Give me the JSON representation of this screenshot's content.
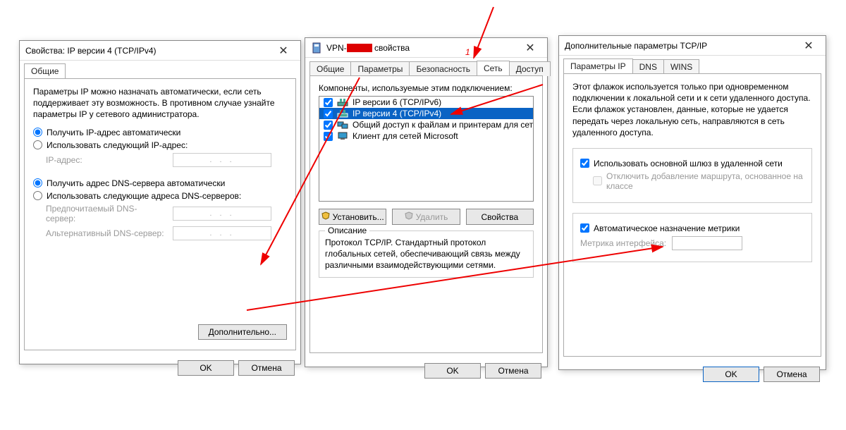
{
  "annotations": {
    "label_1": "1"
  },
  "dialog1": {
    "title": "Свойства: IP версии 4 (TCP/IPv4)",
    "tabs": {
      "general": "Общие"
    },
    "intro": "Параметры IP можно назначать автоматически, если сеть поддерживает эту возможность. В противном случае узнайте параметры IP у сетевого администратора.",
    "radio_auto_ip": "Получить IP-адрес автоматически",
    "radio_manual_ip": "Использовать следующий IP-адрес:",
    "ip_label": "IP-адрес:",
    "ip_placeholder": ".     .     .",
    "radio_auto_dns": "Получить адрес DNS-сервера автоматически",
    "radio_manual_dns": "Использовать следующие адреса DNS-серверов:",
    "dns_pref": "Предпочитаемый DNS-сервер:",
    "dns_alt": "Альтернативный DNS-сервер:",
    "advanced_btn": "Дополнительно...",
    "ok": "OK",
    "cancel": "Отмена"
  },
  "dialog2": {
    "title_prefix": "VPN-",
    "title_suffix": "свойства",
    "tabs": {
      "general": "Общие",
      "params": "Параметры",
      "security": "Безопасность",
      "network": "Сеть",
      "access": "Доступ"
    },
    "list_caption": "Компоненты, используемые этим подключением:",
    "items": [
      {
        "label": "IP версии 6 (TCP/IPv6)",
        "checked": true,
        "selected": false,
        "icon": "proto"
      },
      {
        "label": "IP версии 4 (TCP/IPv4)",
        "checked": true,
        "selected": true,
        "icon": "proto"
      },
      {
        "label": "Общий доступ к файлам и принтерам для сетей Micr...",
        "checked": true,
        "selected": false,
        "icon": "share"
      },
      {
        "label": "Клиент для сетей Microsoft",
        "checked": true,
        "selected": false,
        "icon": "client"
      }
    ],
    "install_btn": "Установить...",
    "remove_btn": "Удалить",
    "props_btn": "Свойства",
    "desc_title": "Описание",
    "desc_body": "Протокол TCP/IP. Стандартный протокол глобальных сетей, обеспечивающий связь между различными взаимодействующими сетями.",
    "ok": "OK",
    "cancel": "Отмена"
  },
  "dialog3": {
    "title": "Дополнительные параметры TCP/IP",
    "tabs": {
      "ip": "Параметры IP",
      "dns": "DNS",
      "wins": "WINS"
    },
    "intro": "Этот флажок используется только при одновременном подключении к локальной сети и к сети удаленного доступа. Если флажок установлен, данные, которые не удается передать через локальную сеть, направляются в сеть удаленного доступа.",
    "chk_gateway": "Использовать основной шлюз в удаленной сети",
    "chk_route": "Отключить добавление маршрута, основанное на классе",
    "chk_metric": "Автоматическое назначение метрики",
    "metric_label": "Метрика интерфейса:",
    "ok": "OK",
    "cancel": "Отмена"
  }
}
